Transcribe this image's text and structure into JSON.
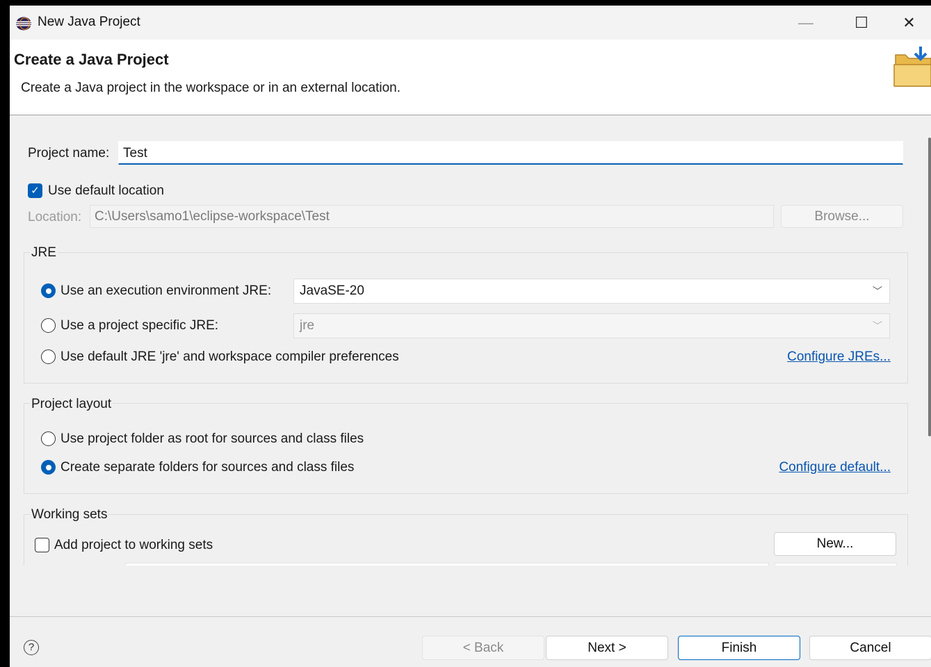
{
  "window": {
    "title": "New Java Project",
    "icon": "eclipse-icon",
    "minimize": "—",
    "maximize": "☐",
    "close": "✕"
  },
  "header": {
    "title": "Create a Java Project",
    "description": "Create a Java project in the workspace or in an external location.",
    "icon": "folder-icon"
  },
  "project_name": {
    "label": "Project name:",
    "value": "Test"
  },
  "location": {
    "use_default_label": "Use default location",
    "use_default_checked": true,
    "label": "Location:",
    "value": "C:\\Users\\samo1\\eclipse-workspace\\Test",
    "browse_label": "Browse..."
  },
  "jre": {
    "title": "JRE",
    "exec_env_label": "Use an execution environment JRE:",
    "exec_env_value": "JavaSE-20",
    "project_specific_label": "Use a project specific JRE:",
    "project_specific_value": "jre",
    "default_label": "Use default JRE 'jre' and workspace compiler preferences",
    "configure_link": "Configure JREs...",
    "selected": "exec_env"
  },
  "layout": {
    "title": "Project layout",
    "root_label": "Use project folder as root for sources and class files",
    "separate_label": "Create separate folders for sources and class files",
    "configure_link": "Configure default...",
    "selected": "separate"
  },
  "working_sets": {
    "title": "Working sets",
    "add_label": "Add project to working sets",
    "add_checked": false,
    "new_label": "New..."
  },
  "footer": {
    "help": "?",
    "back": "< Back",
    "next": "Next >",
    "finish": "Finish",
    "cancel": "Cancel"
  },
  "colors": {
    "accent": "#005fb8",
    "link": "#0a55b0",
    "background": "#f0f0f0"
  }
}
